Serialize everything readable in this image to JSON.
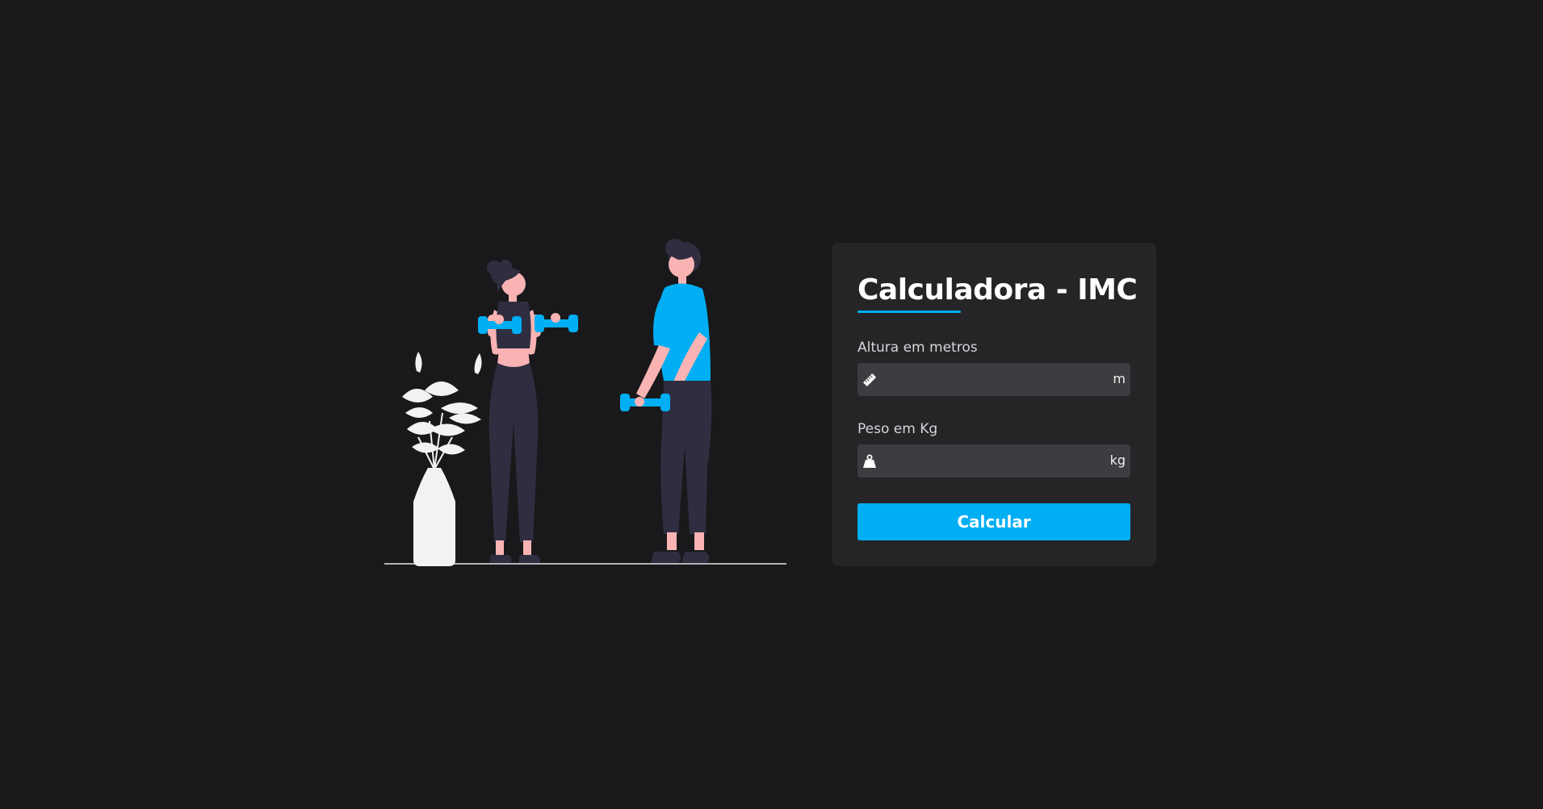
{
  "colors": {
    "background": "#19191b",
    "card": "#252527",
    "input": "#3d3d41",
    "accent": "#00aef4",
    "skin": "#f9b3b3",
    "clothing_dark": "#2f2e41",
    "plant": "#f2f2f2"
  },
  "illustration": {
    "icon": "fitness-people-illustration"
  },
  "calculator": {
    "title": "Calculadora - IMC",
    "height_field": {
      "label": "Altura em metros",
      "value": "",
      "placeholder": "",
      "unit": "m",
      "icon": "ruler-icon"
    },
    "weight_field": {
      "label": "Peso em Kg",
      "value": "",
      "placeholder": "",
      "unit": "kg",
      "icon": "weight-icon"
    },
    "button_label": "Calcular"
  }
}
